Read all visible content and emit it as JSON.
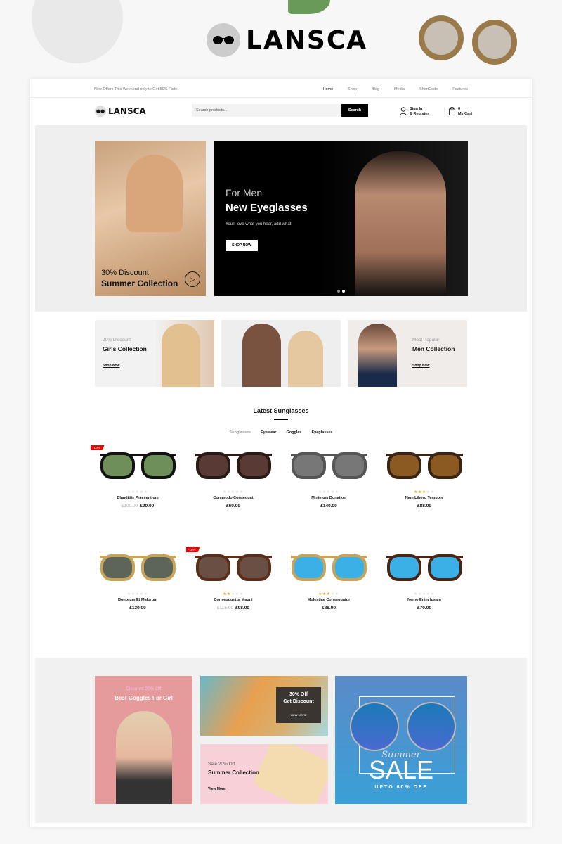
{
  "brand": {
    "name": "LANSCA"
  },
  "topbar": {
    "offer": "New Offers This Weekend only to Get 50% Flate.",
    "nav": [
      "Home",
      "Shop",
      "Blog",
      "Media",
      "ShortCode",
      "Features"
    ]
  },
  "header": {
    "search_placeholder": "Search products...",
    "search_button": "Search",
    "signin_line1": "Sign In",
    "signin_line2": "& Register",
    "cart_count": "0",
    "cart_label": "My Cart"
  },
  "hero": {
    "side": {
      "sub": "30% Discount",
      "title": "Summer Collection"
    },
    "main": {
      "sub": "For Men",
      "title": "New Eyeglasses",
      "text": "You'll love what you hear, add what",
      "button": "SHOP NOW"
    }
  },
  "categories": [
    {
      "sub": "20% Discount",
      "title": "Girls Collection",
      "link": "Shop Now"
    },
    {
      "sub": "Most Popular",
      "title": "Men Collection",
      "link": "Shop Now"
    }
  ],
  "latest": {
    "title": "Latest Sunglasses",
    "tabs": [
      "Sunglasses",
      "Eyewear",
      "Goggles",
      "Eyeglasses"
    ],
    "products": [
      {
        "name": "Blanditiis Praesentium",
        "old_price": "£100.00",
        "price": "£90.00",
        "rating": 0,
        "badge": "-10%",
        "lens": "#6f8f5a",
        "frame": "#111"
      },
      {
        "name": "Commodo Consequat",
        "old_price": "",
        "price": "£60.00",
        "rating": 0,
        "badge": "",
        "lens": "#5a3a34",
        "frame": "#2a1a16"
      },
      {
        "name": "Minimum Donation",
        "old_price": "",
        "price": "£140.00",
        "rating": 0,
        "badge": "",
        "lens": "#777",
        "frame": "#555"
      },
      {
        "name": "Nam Libero Tempore",
        "old_price": "",
        "price": "£88.00",
        "rating": 3,
        "badge": "",
        "lens": "#8a5a22",
        "frame": "#3a2414"
      },
      {
        "name": "Bonorum Et Malorum",
        "old_price": "",
        "price": "£130.00",
        "rating": 0,
        "badge": "",
        "lens": "#5d6458",
        "frame": "#c8a35a"
      },
      {
        "name": "Consequuntur Magni",
        "old_price": "£115.00",
        "price": "£98.00",
        "rating": 2,
        "badge": "-15%",
        "lens": "#6a5044",
        "frame": "#5a2e1a"
      },
      {
        "name": "Molestiae Consequatur",
        "old_price": "",
        "price": "£88.00",
        "rating": 3,
        "badge": "",
        "lens": "#3ab0e6",
        "frame": "#c8a35a"
      },
      {
        "name": "Nemo Enim Ipsam",
        "old_price": "",
        "price": "£70.00",
        "rating": 0,
        "badge": "",
        "lens": "#3ab0e6",
        "frame": "#4a2414"
      }
    ]
  },
  "promos": {
    "girl": {
      "sub": "Discount 20% Off",
      "title": "Best Goggles For Girl"
    },
    "discount": {
      "title1": "30% Off",
      "title2": "Get Discount",
      "link": "VIEW MORE"
    },
    "summer": {
      "sub": "Sale 20% Off",
      "title": "Summer Collection",
      "link": "View More"
    },
    "sale": {
      "script": "Summer",
      "title": "SALE",
      "sub": "UPTO 60% OFF"
    }
  }
}
